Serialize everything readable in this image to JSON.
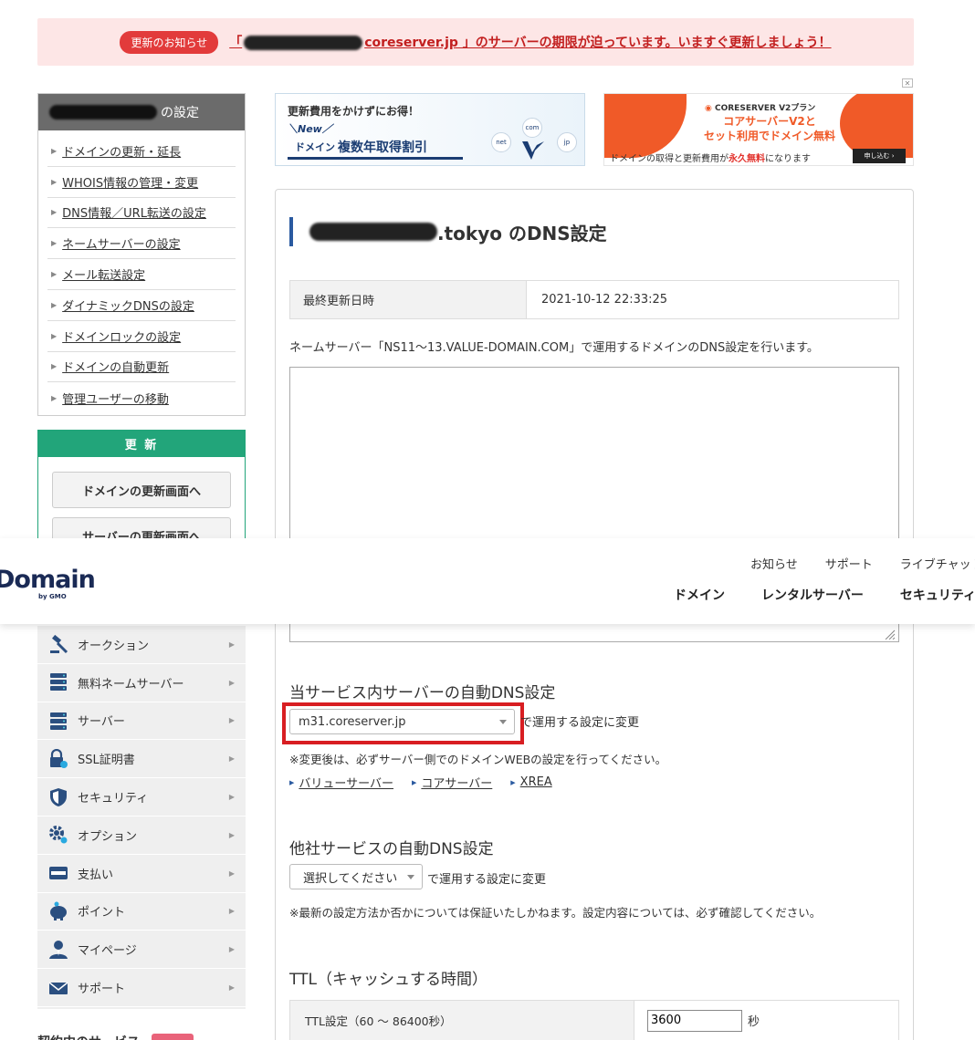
{
  "notice": {
    "badge": "更新のお知らせ",
    "prefix": "「",
    "text": "coreserver.jp 」のサーバーの期限が迫っています。いますぐ更新しましょう！"
  },
  "sidebar": {
    "header_suffix": "の設定",
    "items": [
      {
        "label": "ドメインの更新・延長"
      },
      {
        "label": "WHOIS情報の管理・変更"
      },
      {
        "label": "DNS情報／URL転送の設定"
      },
      {
        "label": "ネームサーバーの設定"
      },
      {
        "label": "メール転送設定"
      },
      {
        "label": "ダイナミックDNSの設定"
      },
      {
        "label": "ドメインロックの設定"
      },
      {
        "label": "ドメインの自動更新"
      },
      {
        "label": "管理ユーザーの移動"
      }
    ]
  },
  "renew": {
    "title": "更 新",
    "domain_button": "ドメインの更新画面へ",
    "server_button": "サーバーの更新画面へ"
  },
  "header": {
    "logo": "Domain",
    "logo_sub": "by GMO",
    "top_links": [
      "お知らせ",
      "サポート",
      "ライブチャット"
    ],
    "nav": [
      "ドメイン",
      "レンタルサーバー",
      "セキュリティ"
    ]
  },
  "category_nav": [
    {
      "label": "オークション",
      "icon": "gavel-icon"
    },
    {
      "label": "無料ネームサーバー",
      "icon": "server-stack-icon"
    },
    {
      "label": "サーバー",
      "icon": "server-icon"
    },
    {
      "label": "SSL証明書",
      "icon": "ssl-lock-icon"
    },
    {
      "label": "セキュリティ",
      "icon": "shield-icon"
    },
    {
      "label": "オプション",
      "icon": "gear-icon"
    },
    {
      "label": "支払い",
      "icon": "credit-card-icon"
    },
    {
      "label": "ポイント",
      "icon": "piggy-bank-icon"
    },
    {
      "label": "マイページ",
      "icon": "user-icon"
    },
    {
      "label": "サポート",
      "icon": "mail-icon"
    }
  ],
  "below_nav_title": "契約中のサービス",
  "banner1": {
    "line1": "更新費用をかけずにお得！",
    "line2": "＼New／",
    "box_small": "ドメイン",
    "box_big": "複数年取得割引",
    "tags": [
      "com",
      "net",
      "jp"
    ]
  },
  "ad_close": "✕",
  "banner2": {
    "brand": "CORESERVER V2プラン",
    "main1": "コアサーバーV2と",
    "main2": "セット利用でドメイン無料",
    "bottom_pre": "ドメインの取得と更新費用が",
    "bottom_red": "永久無料",
    "bottom_post": "になります",
    "button": "申し込む ›"
  },
  "page": {
    "title_suffix": ".tokyo のDNS設定",
    "last_updated_label": "最終更新日時",
    "last_updated_value": "2021-10-12 22:33:25",
    "description": "ネームサーバー「NS11～13.VALUE-DOMAIN.COM」で運用するドメインのDNS設定を行います。",
    "dns_records": ""
  },
  "auto_dns": {
    "title": "当サービス内サーバーの自動DNS設定",
    "selected": "m31.coreserver.jp",
    "suffix": "で運用する設定に変更",
    "note": "※変更後は、必ずサーバー側でのドメインWEBの設定を行ってください。",
    "links": [
      "バリューサーバー",
      "コアサーバー",
      "XREA"
    ]
  },
  "other_dns": {
    "title": "他社サービスの自動DNS設定",
    "selected": "選択してください",
    "suffix": "で運用する設定に変更",
    "note": "※最新の設定方法か否かについては保証いたしかねます。設定内容については、必ず確認してください。"
  },
  "ttl": {
    "title": "TTL（キャッシュする時間）",
    "label": "TTL設定（60 ～ 86400秒）",
    "value": "3600",
    "unit": "秒"
  },
  "colors": {
    "accent_red": "#d81e22",
    "green": "#22a57a",
    "navy": "#1a2a55",
    "orange": "#f05a28"
  }
}
